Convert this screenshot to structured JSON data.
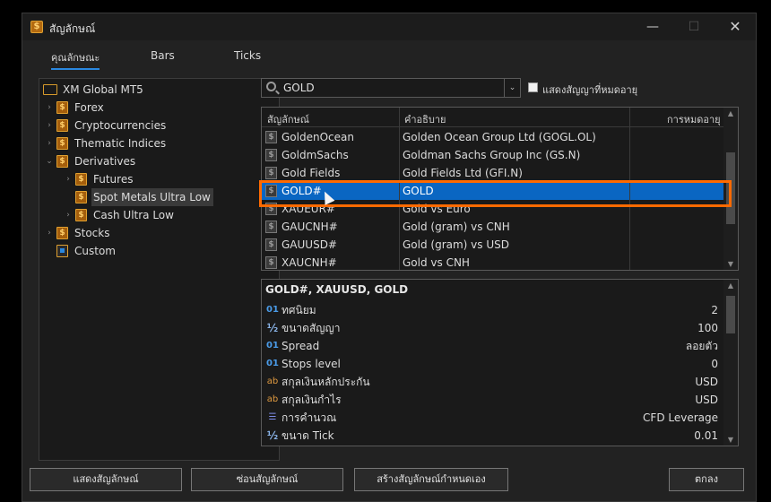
{
  "window": {
    "title": "สัญลักษณ์",
    "min_symbol": "—",
    "max_symbol": "☐",
    "close_symbol": "✕",
    "app_icon": "dollar-icon"
  },
  "tabs": [
    {
      "label": "คุณลักษณะ",
      "active": true
    },
    {
      "label": "Bars",
      "active": false
    },
    {
      "label": "Ticks",
      "active": false
    }
  ],
  "tree": {
    "root": "XM Global MT5",
    "items": [
      {
        "label": "Forex",
        "chevron": "›"
      },
      {
        "label": "Cryptocurrencies",
        "chevron": "›"
      },
      {
        "label": "Thematic Indices",
        "chevron": "›"
      },
      {
        "label": "Derivatives",
        "chevron": "⌄"
      },
      {
        "label": "Futures",
        "chevron": "›"
      },
      {
        "label": "Spot Metals Ultra Low",
        "chevron": "",
        "selected": true
      },
      {
        "label": "Cash Ultra Low",
        "chevron": "›"
      },
      {
        "label": "Stocks",
        "chevron": "›"
      },
      {
        "label": "Custom",
        "chevron": ""
      }
    ]
  },
  "search": {
    "value": "GOLD",
    "dropdown_symbol": "⌄"
  },
  "show_expired": {
    "label": "แสดงสัญญาที่หมดอายุ",
    "checked": false
  },
  "symbols_table": {
    "columns": [
      "สัญลักษณ์",
      "คำอธิบาย",
      "การหมดอายุ"
    ],
    "rows": [
      {
        "symbol": "GoldenOcean",
        "description": "Golden Ocean Group Ltd (GOGL.OL)",
        "expiry": ""
      },
      {
        "symbol": "GoldmSachs",
        "description": "Goldman Sachs Group Inc (GS.N)",
        "expiry": ""
      },
      {
        "symbol": "Gold Fields",
        "description": "Gold Fields Ltd (GFI.N)",
        "expiry": ""
      },
      {
        "symbol": "GOLD#",
        "description": "GOLD",
        "expiry": "",
        "selected": true
      },
      {
        "symbol": "XAUEUR#",
        "description": "Gold vs Euro",
        "expiry": ""
      },
      {
        "symbol": "GAUCNH#",
        "description": "Gold (gram) vs CNH",
        "expiry": ""
      },
      {
        "symbol": "GAUUSD#",
        "description": "Gold (gram) vs USD",
        "expiry": ""
      },
      {
        "symbol": "XAUCNH#",
        "description": "Gold vs CNH",
        "expiry": ""
      }
    ]
  },
  "properties": {
    "title": "GOLD#, XAUUSD, GOLD",
    "rows": [
      {
        "icon": "01",
        "kind": "num",
        "name": "ทศนิยม",
        "value": "2"
      },
      {
        "icon": "½",
        "kind": "half",
        "name": "ขนาดสัญญา",
        "value": "100"
      },
      {
        "icon": "01",
        "kind": "num",
        "name": "Spread",
        "value": "ลอยตัว"
      },
      {
        "icon": "01",
        "kind": "num",
        "name": "Stops level",
        "value": "0"
      },
      {
        "icon": "ab",
        "kind": "ab",
        "name": "สกุลเงินหลักประกัน",
        "value": "USD"
      },
      {
        "icon": "ab",
        "kind": "ab",
        "name": "สกุลเงินกำไร",
        "value": "USD"
      },
      {
        "icon": "☰",
        "kind": "list",
        "name": "การคำนวณ",
        "value": "CFD Leverage"
      },
      {
        "icon": "½",
        "kind": "half",
        "name": "ขนาด Tick",
        "value": "0.01"
      }
    ]
  },
  "footer": {
    "show_symbol": "แสดงสัญลักษณ์",
    "hide_symbol": "ซ่อนสัญลักษณ์",
    "create_custom": "สร้างสัญลักษณ์กำหนดเอง",
    "ok": "ตกลง"
  },
  "colors": {
    "accent": "#0a66c2",
    "highlight": "#ff6a00",
    "folder": "#d79a2b"
  }
}
